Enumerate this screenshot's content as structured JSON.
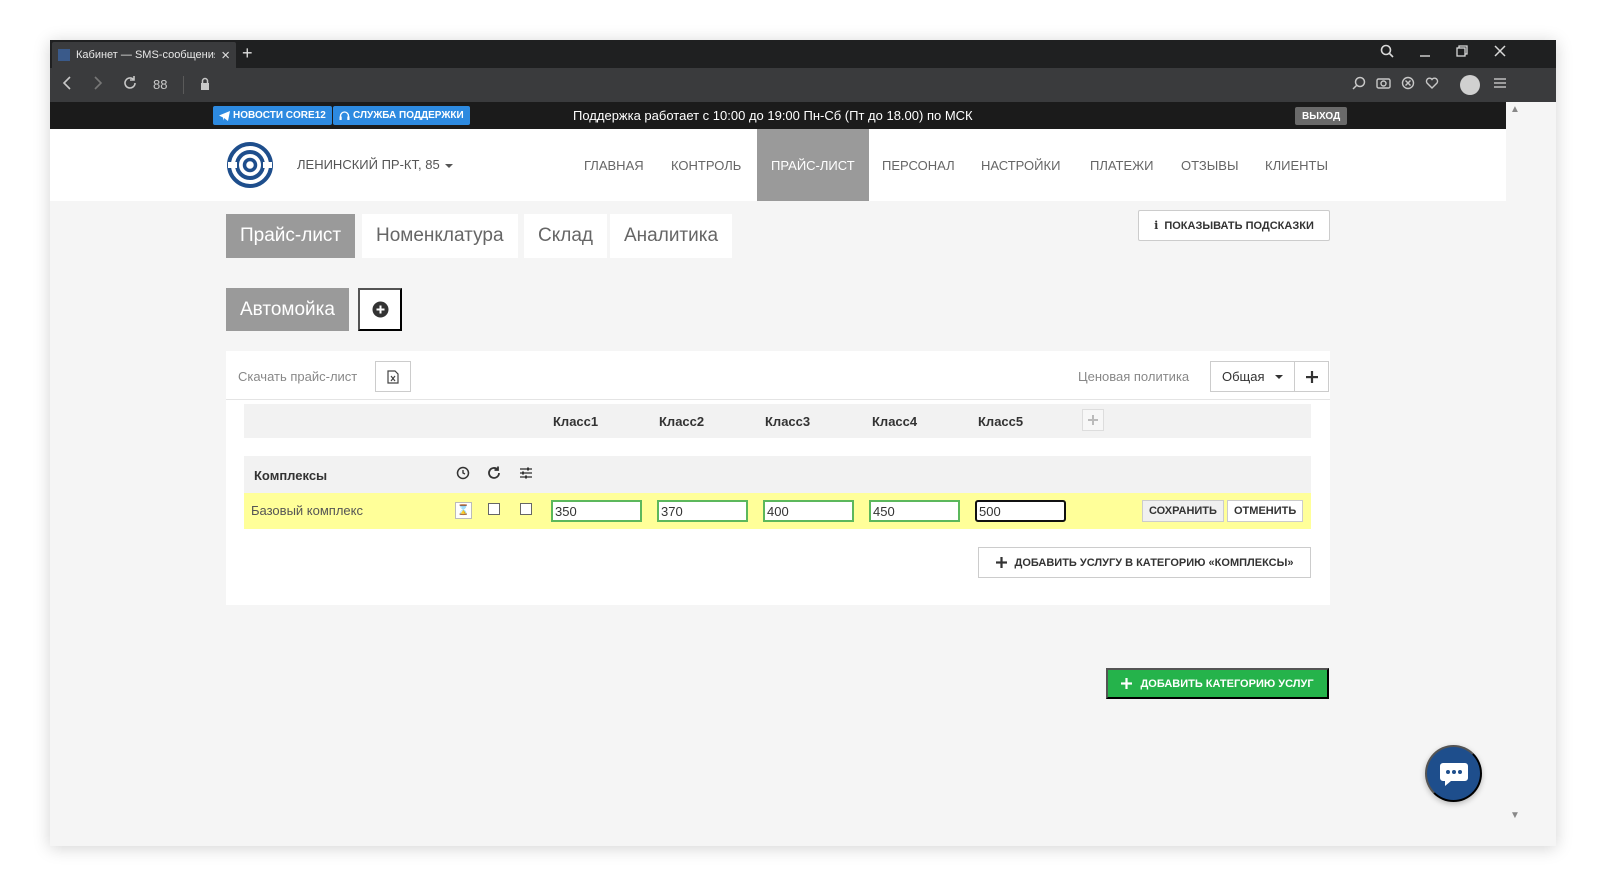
{
  "browser": {
    "tab_title": "Кабинет — SMS-сообщения",
    "new_tab": "+",
    "speed_dial": "88"
  },
  "topbar": {
    "news_badge": "НОВОСТИ CORE12",
    "support_badge": "СЛУЖБА ПОДДЕРЖКИ",
    "support_hours": "Поддержка работает с 10:00 до 19:00 Пн-Сб (Пт до 18.00) по МСК",
    "exit": "ВЫХОД"
  },
  "header": {
    "location": "ЛЕНИНСКИЙ ПР-КТ, 85",
    "nav": [
      {
        "label": "ГЛАВНАЯ"
      },
      {
        "label": "КОНТРОЛЬ"
      },
      {
        "label": "ПРАЙС-ЛИСТ"
      },
      {
        "label": "ПЕРСОНАЛ"
      },
      {
        "label": "НАСТРОЙКИ"
      },
      {
        "label": "ПЛАТЕЖИ"
      },
      {
        "label": "ОТЗЫВЫ"
      },
      {
        "label": "КЛИЕНТЫ"
      }
    ],
    "active_nav": "ПРАЙС-ЛИСТ"
  },
  "subtabs": [
    {
      "label": "Прайс-лист"
    },
    {
      "label": "Номенклатура"
    },
    {
      "label": "Склад"
    },
    {
      "label": "Аналитика"
    }
  ],
  "hints_button": "ПОКАЗЫВАТЬ ПОДСКАЗКИ",
  "category_tab": "Автомойка",
  "pricelist": {
    "download_label": "Скачать прайс-лист",
    "policy_label": "Ценовая политика",
    "policy_value": "Общая",
    "classes": [
      "Класс1",
      "Класс2",
      "Класс3",
      "Класс4",
      "Класс5"
    ],
    "group_title": "Комплексы",
    "row": {
      "name": "Базовый комплекс",
      "prices": [
        "350",
        "370",
        "400",
        "450",
        "500"
      ],
      "save": "СОХРАНИТЬ",
      "cancel": "ОТМЕНИТЬ"
    },
    "add_service": "ДОБАВИТЬ УСЛУГУ В КАТЕГОРИЮ «КОМПЛЕКСЫ»"
  },
  "add_category": "ДОБАВИТЬ КАТЕГОРИЮ УСЛУГ",
  "colors": {
    "accent_green": "#25b34b",
    "active_gray": "#9a9a9a",
    "badge_blue": "#2d8ae0",
    "row_highlight": "#ffff99",
    "chat_blue": "#1e4e8c"
  }
}
